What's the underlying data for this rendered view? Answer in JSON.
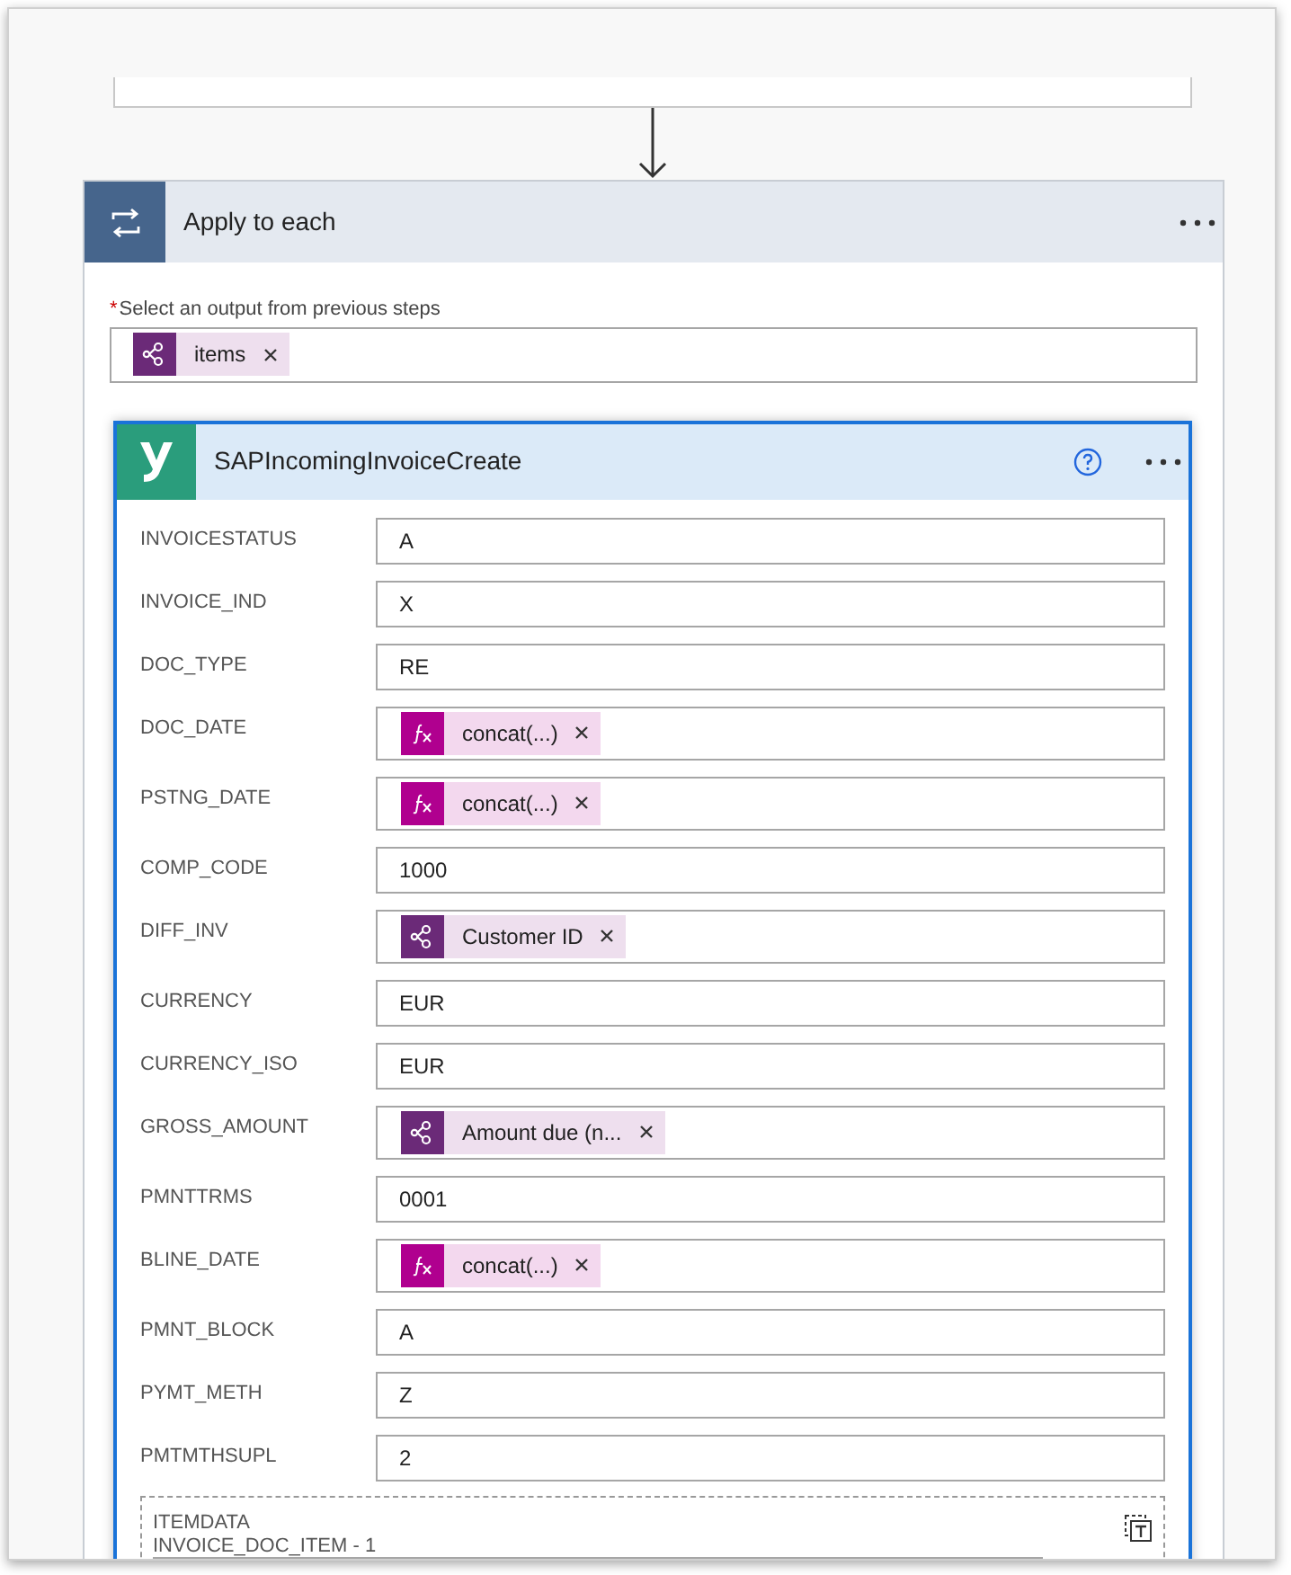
{
  "loop": {
    "title": "Apply to each",
    "select_label": "Select an output from previous steps",
    "required_mark": "*",
    "tokens": [
      {
        "kind": "dynamic",
        "label": "items"
      }
    ]
  },
  "action": {
    "title": "SAPIncomingInvoiceCreate",
    "fields": [
      {
        "label": "INVOICESTATUS",
        "value": "A"
      },
      {
        "label": "INVOICE_IND",
        "value": "X"
      },
      {
        "label": "DOC_TYPE",
        "value": "RE"
      },
      {
        "label": "DOC_DATE",
        "token": {
          "kind": "expression",
          "label": "concat(...)"
        }
      },
      {
        "label": "PSTNG_DATE",
        "token": {
          "kind": "expression",
          "label": "concat(...)"
        }
      },
      {
        "label": "COMP_CODE",
        "value": "1000"
      },
      {
        "label": "DIFF_INV",
        "token": {
          "kind": "dynamic",
          "label": "Customer ID"
        }
      },
      {
        "label": "CURRENCY",
        "value": "EUR"
      },
      {
        "label": "CURRENCY_ISO",
        "value": "EUR"
      },
      {
        "label": "GROSS_AMOUNT",
        "token": {
          "kind": "dynamic",
          "label": "Amount due (n..."
        }
      },
      {
        "label": "PMNTTRMS",
        "value": "0001"
      },
      {
        "label": "BLINE_DATE",
        "token": {
          "kind": "expression",
          "label": "concat(...)"
        }
      },
      {
        "label": "PMNT_BLOCK",
        "value": "A"
      },
      {
        "label": "PYMT_METH",
        "value": "Z"
      },
      {
        "label": "PMTMTHSUPL",
        "value": "2"
      }
    ],
    "array": {
      "title": "ITEMDATA",
      "item_label": "INVOICE_DOC_ITEM - 1"
    }
  }
}
